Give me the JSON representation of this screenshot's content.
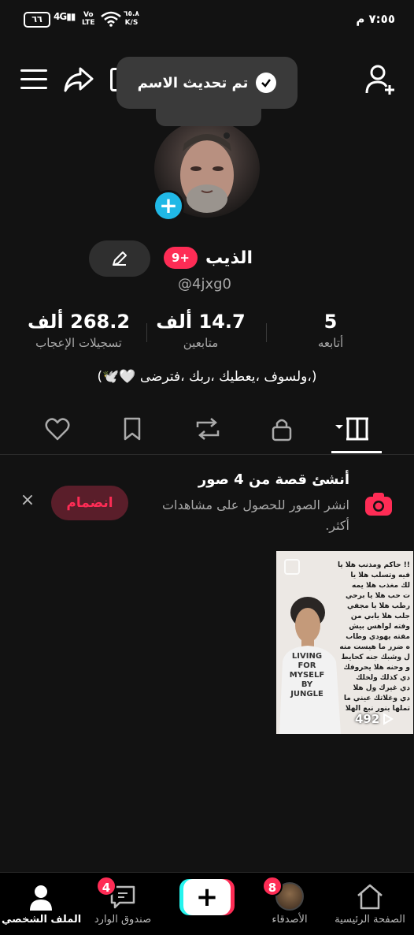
{
  "status_bar": {
    "time": "٧:٥٥ م",
    "battery": "٦٦",
    "network": "4G",
    "volte": "Vo\nLTE",
    "speed": "٦٥.٨",
    "speed_unit": "K/S"
  },
  "toast": {
    "message": "تم تحديث الاسم"
  },
  "profile": {
    "name": "الذيب",
    "name_badge": "9+",
    "handle": "@4jxg0",
    "bio": "(،ولسوف ،يعطيك ،ربك ،فترضى 🤍🕊️)"
  },
  "stats": [
    {
      "value": "5",
      "label": "أتابعه"
    },
    {
      "value": "14.7 ألف",
      "label": "متابعين"
    },
    {
      "value": "268.2 ألف",
      "label": "تسجيلات الإعجاب"
    }
  ],
  "tabs": [
    "videos-grid-icon",
    "lock-icon",
    "repost-icon",
    "bookmark-icon",
    "heart-icon"
  ],
  "story_card": {
    "title": "أنشئ قصة من 4 صور",
    "subtitle": "انشر الصور للحصول على مشاهدات أكثر.",
    "join_label": "انضمام",
    "close_label": "×"
  },
  "video": {
    "views": "492",
    "overlay_text": "!! حاكم ومذنب هلا يا\nفيه وتسلب هلا يا\nلك مغذب هلا يمه\nت حب هلا يا برحي\nرطب هلا يا مجفي\nجلب هلا يابي من\nوفته لواهس بيش\nمفته يهودي وطاب\nه ضرر ما هيست منه\nل وشبك جنه كحايط\nو وحنه هلا يحروفك\nدي كذلك ولخلك\nدي غيرك ول هلا\nدي وغلاتك عيني ما\nتملها بنور نبع الهلا",
    "shirt_text": "LIVING\nFOR\nMYSELF\nBY\nJUNGLE"
  },
  "bottom_nav": {
    "home": "الصفحة الرئيسية",
    "friends": "الأصدقاء",
    "friends_badge": "8",
    "create": "+",
    "inbox": "صندوق الوارد",
    "inbox_badge": "4",
    "profile": "الملف الشخصي"
  }
}
